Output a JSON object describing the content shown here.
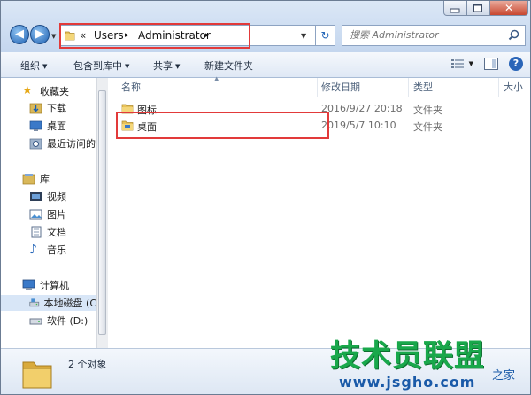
{
  "address": {
    "overflow": "«",
    "crumbs": [
      "Users",
      "Administrator"
    ],
    "separator": "▸"
  },
  "search": {
    "placeholder": "搜索 Administrator"
  },
  "toolbar": {
    "organize": "组织",
    "include_in_library": "包含到库中",
    "share": "共享",
    "new_folder": "新建文件夹"
  },
  "navpane": {
    "favorites": {
      "label": "收藏夹",
      "items": [
        "下载",
        "桌面",
        "最近访问的"
      ]
    },
    "libraries": {
      "label": "库",
      "items": [
        "视频",
        "图片",
        "文档",
        "音乐"
      ]
    },
    "computer": {
      "label": "计算机",
      "items": [
        "本地磁盘 (C",
        "软件 (D:)"
      ]
    }
  },
  "columns": {
    "name": "名称",
    "modified": "修改日期",
    "type": "类型",
    "size": "大小"
  },
  "files": [
    {
      "name": "图标",
      "modified": "2016/9/27 20:18",
      "type": "文件夹"
    },
    {
      "name": "桌面",
      "modified": "2019/5/7 10:10",
      "type": "文件夹"
    }
  ],
  "status": {
    "text": "2 个对象"
  },
  "watermark": {
    "title": "技术员联盟",
    "suffix": "之家",
    "url": "www.jsgho.com"
  },
  "colors": {
    "highlight": "#e23a3a",
    "accent": "#2466b8",
    "watermark_green": "#19a84b"
  }
}
